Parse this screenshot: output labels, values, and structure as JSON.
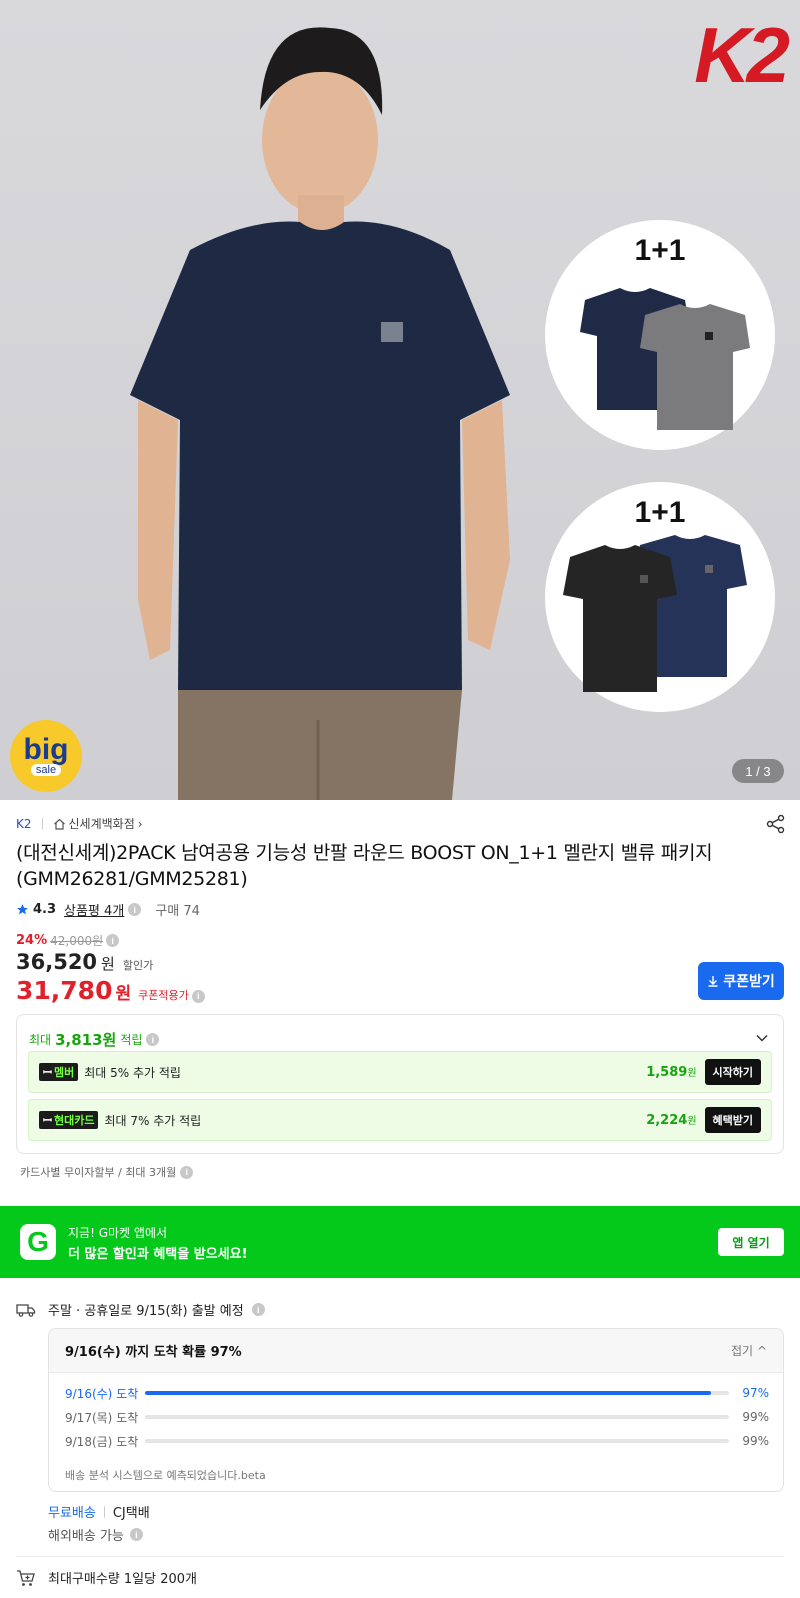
{
  "hero": {
    "brand_logo": "K2",
    "promo_1": "1+1",
    "promo_2": "1+1",
    "badge_big": "big",
    "badge_sale": "sale",
    "pager": "1 / 3"
  },
  "product": {
    "brand": "K2",
    "store": "신세계백화점",
    "title": "(대전신세계)2PACK 남여공용 기능성 반팔 라운드 BOOST ON_1+1 멜란지 밸류 패키지 (GMM26281/GMM25281)",
    "rating": "4.3",
    "review_label": "상품평 4개",
    "purchase_label": "구매 74"
  },
  "price": {
    "discount_rate": "24%",
    "original": "42,000",
    "original_unit": "원",
    "sale": "36,520",
    "sale_unit": "원",
    "sale_label": "할인가",
    "coupon": "31,780",
    "coupon_unit": "원",
    "coupon_label": "쿠폰적용가",
    "coupon_button": "쿠폰받기"
  },
  "points": {
    "prefix": "최대",
    "amount": "3,813원",
    "suffix": "적립",
    "rows": [
      {
        "badge": "멤버",
        "desc": "최대 5% 추가 적립",
        "amount": "1,589",
        "unit": "원",
        "action": "시작하기"
      },
      {
        "badge": "현대카드",
        "desc": "최대 7% 추가 적립",
        "amount": "2,224",
        "unit": "원",
        "action": "혜택받기"
      }
    ]
  },
  "installment": "카드사별 무이자할부 / 최대 3개월",
  "app_banner": {
    "line1": "지금! G마켓 앱에서",
    "line2": "더 많은 할인과 혜택을 받으세요!",
    "button": "앱 열기"
  },
  "delivery": {
    "ship_text": "주말 · 공휴일로 9/15(화) 출발 예정",
    "box_title": "9/16(수) 까지 도착 확률 97%",
    "fold_label": "접기",
    "rows": [
      {
        "label": "9/16(수) 도착",
        "pct": "97%",
        "value": 97
      },
      {
        "label": "9/17(목) 도착",
        "pct": "99%",
        "value": 99
      },
      {
        "label": "9/18(금) 도착",
        "pct": "99%",
        "value": 99
      }
    ],
    "note": "배송 분석 시스템으로 예측되었습니다.beta",
    "free": "무료배송",
    "carrier": "CJ택배",
    "overseas": "해외배송 가능",
    "max_buy": "최대구매수량 1일당 200개"
  },
  "colors": {
    "accent_blue": "#1a6af0",
    "discount_red": "#e0202a",
    "gmarket_green": "#05c91a",
    "point_green": "#17a50d"
  }
}
